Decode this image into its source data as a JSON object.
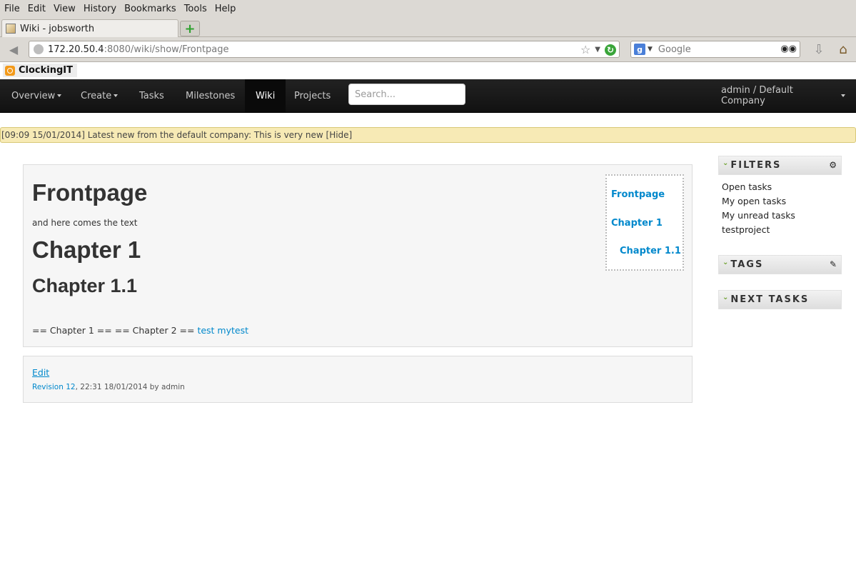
{
  "browser": {
    "menu": [
      "File",
      "Edit",
      "View",
      "History",
      "Bookmarks",
      "Tools",
      "Help"
    ],
    "tab_title": "Wiki - jobsworth",
    "url_host": "172.20.50.4",
    "url_rest": ":8080/wiki/show/Frontpage",
    "search_engine_placeholder": "Google",
    "bookmark": "ClockingIT"
  },
  "nav": {
    "overview": "Overview",
    "create": "Create",
    "tasks": "Tasks",
    "milestones": "Milestones",
    "wiki": "Wiki",
    "projects": "Projects",
    "search_placeholder": "Search...",
    "user": "admin / Default Company"
  },
  "news": {
    "text": "[09:09 15/01/2014] Latest new from the default company: This is very new [Hide]"
  },
  "wiki": {
    "title": "Frontpage",
    "body": "and here comes the text",
    "chapter1": "Chapter 1",
    "chapter11": "Chapter 1.1",
    "raw_text": "== Chapter 1 == == Chapter 2 == ",
    "raw_link": "test mytest",
    "toc": [
      "Frontpage",
      "Chapter 1",
      "Chapter 1.1"
    ]
  },
  "meta": {
    "edit": "Edit",
    "revision_link": "Revision 12",
    "revision_rest": ", 22:31 18/01/2014 by admin"
  },
  "sidebar": {
    "filters_title": "FILTERS",
    "filters": [
      "Open tasks",
      "My open tasks",
      "My unread tasks",
      "testproject"
    ],
    "tags_title": "TAGS",
    "next_tasks_title": "NEXT TASKS"
  }
}
